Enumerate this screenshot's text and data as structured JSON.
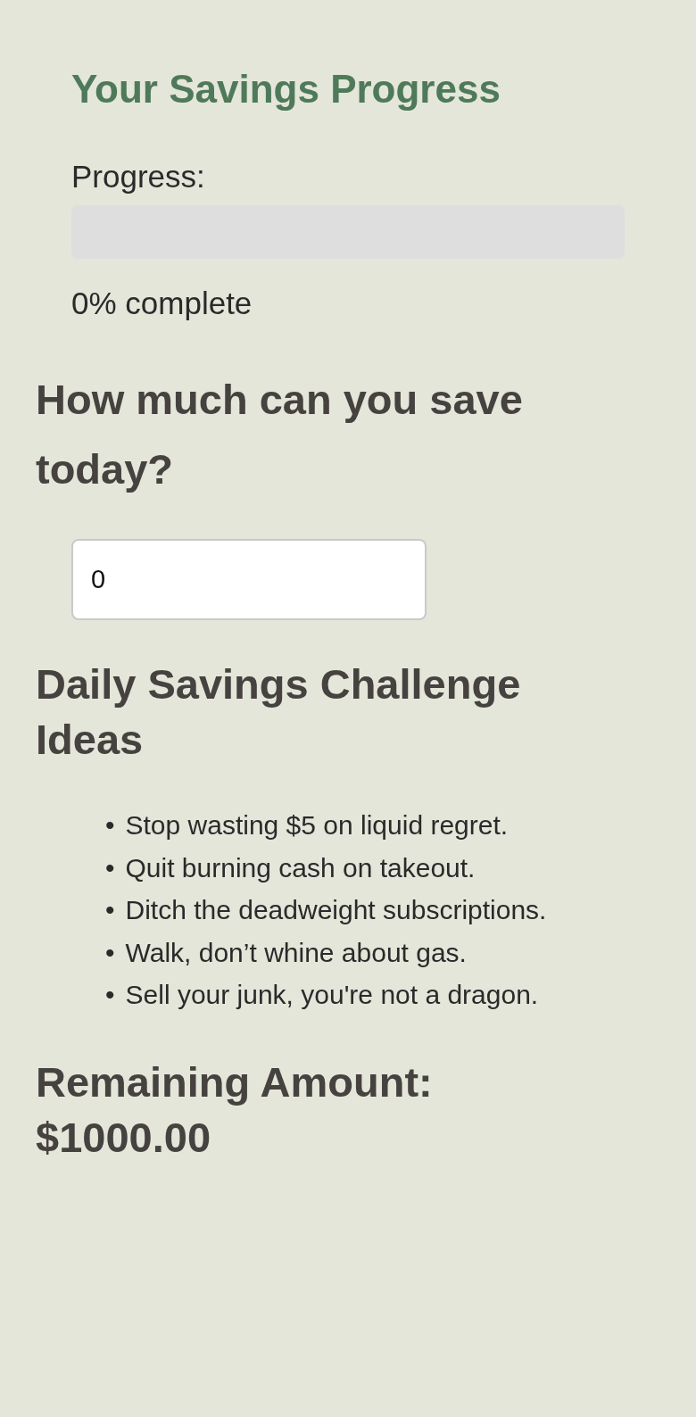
{
  "title": "Your Savings Progress",
  "progress": {
    "label": "Progress:",
    "level": 0,
    "status": "0% complete"
  },
  "save_heading": "How much can you save today?",
  "amount_input": {
    "value": "0"
  },
  "ideas_heading": "Daily Savings Challenge Ideas",
  "ideas": [
    {
      "bullet": "•",
      "text": "Stop wasting $5 on liquid regret."
    },
    {
      "bullet": "•",
      "text": "Quit burning cash on takeout."
    },
    {
      "bullet": "•",
      "text": "Ditch the deadweight subscriptions."
    },
    {
      "bullet": "•",
      "text": "Walk, don’t whine about gas."
    },
    {
      "bullet": "•",
      "text": "Sell your junk, you're not a dragon."
    }
  ],
  "remaining": "Remaining Amount: $1000.00"
}
